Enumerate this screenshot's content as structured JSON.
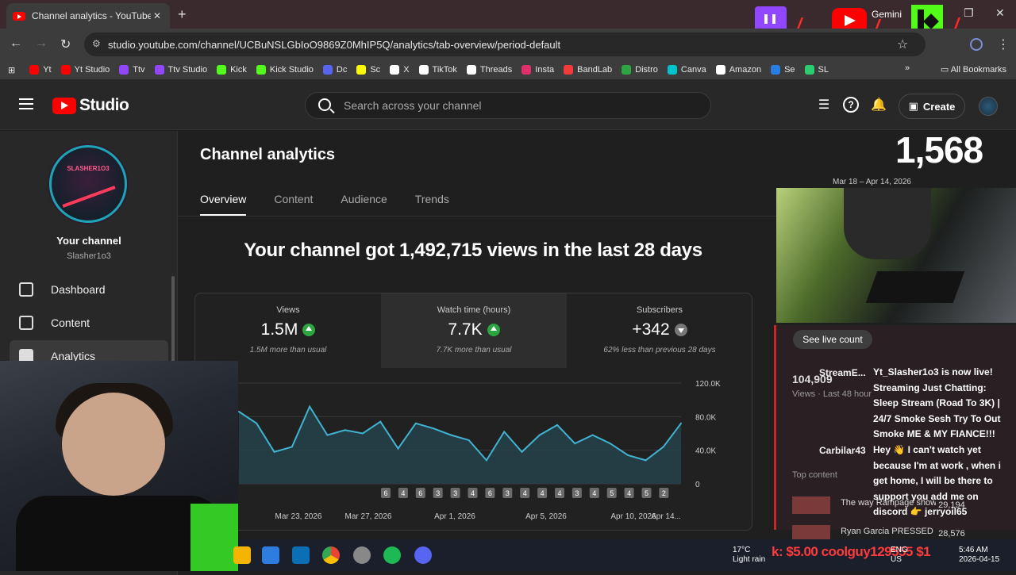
{
  "browser": {
    "tab_title": "Channel analytics - YouTube Stu",
    "url": "studio.youtube.com/channel/UCBuNSLGbIoO9869Z0MhIP5Q/analytics/tab-overview/period-default",
    "gemini_label": "Gemini",
    "bookmarks": [
      "Yt",
      "Yt Studio",
      "Ttv",
      "Ttv Studio",
      "Kick",
      "Kick Studio",
      "Dc",
      "Sc",
      "X",
      "TikTok",
      "Threads",
      "Insta",
      "BandLab",
      "Distro",
      "Canva",
      "Amazon",
      "Se",
      "SL"
    ],
    "bookmark_colors": [
      "#ff0000",
      "#ff0000",
      "#9146ff",
      "#9146ff",
      "#53fc18",
      "#53fc18",
      "#5865f2",
      "#fffc00",
      "#ffffff",
      "#ffffff",
      "#ffffff",
      "#e1306c",
      "#f23c3c",
      "#2ba640",
      "#00c4cc",
      "#ffffff",
      "#2a7de1",
      "#2ecc71"
    ],
    "all_bookmarks": "All Bookmarks"
  },
  "header": {
    "logo_text": "Studio",
    "search_placeholder": "Search across your channel",
    "create_label": "Create"
  },
  "sidebar": {
    "avatar_text": "SLASHER1O3",
    "your_channel": "Your channel",
    "handle": "Slasher1o3",
    "items": [
      {
        "label": "Dashboard"
      },
      {
        "label": "Content"
      },
      {
        "label": "Analytics"
      }
    ]
  },
  "main": {
    "title": "Channel analytics",
    "tabs": [
      "Overview",
      "Content",
      "Audience",
      "Trends"
    ],
    "headline": "Your channel got 1,492,715 views in the last 28 days",
    "metrics": [
      {
        "label": "Views",
        "value": "1.5M",
        "trend": "up",
        "sub": "1.5M more than usual"
      },
      {
        "label": "Watch time (hours)",
        "value": "7.7K",
        "trend": "up",
        "sub": "7.7K more than usual"
      },
      {
        "label": "Subscribers",
        "value": "+342",
        "trend": "down",
        "sub": "62% less than previous 28 days"
      }
    ]
  },
  "chart_data": {
    "type": "area",
    "title": "",
    "xlabel": "",
    "ylabel": "",
    "y_ticks": [
      "120.0K",
      "80.0K",
      "40.0K",
      "0"
    ],
    "ylim": [
      0,
      120000
    ],
    "x_tick_labels": [
      "Mar 23, 2026",
      "Mar 27, 2026",
      "Apr 1, 2026",
      "Apr 5, 2026",
      "Apr 10, 2026",
      "Apr 14..."
    ],
    "values": [
      86000,
      72000,
      38000,
      44000,
      92000,
      58000,
      64000,
      60000,
      74000,
      42000,
      72000,
      66000,
      58000,
      52000,
      28000,
      62000,
      38000,
      58000,
      70000,
      48000,
      58000,
      48000,
      34000,
      28000,
      44000,
      72000
    ],
    "markers": [
      "6",
      "4",
      "6",
      "3",
      "3",
      "4",
      "6",
      "3",
      "4",
      "4",
      "4",
      "3",
      "4",
      "5",
      "4",
      "5",
      "2"
    ],
    "grid": true,
    "colors": {
      "line": "#41b4d2",
      "fill": "#26444d",
      "marker_bg": "#6b6b6b"
    }
  },
  "overlays": {
    "big_count": "1,568",
    "date_range": "Mar 18 – Apr 14, 2026",
    "see_live_count": "See live count",
    "ghost_views_value": "104,909",
    "ghost_views_label": "Views · Last 48 hour",
    "top_content_label": "Top content",
    "top_content": [
      {
        "title": "The way Rampage show...",
        "views": "29,194"
      },
      {
        "title": "Ryan Garcia PRESSED O...",
        "views": "28,576"
      }
    ],
    "chat": [
      {
        "user": "StreamE...",
        "user_color": "#7c5cff",
        "text": "Yt_Slasher1o3 is now live! Streaming Just Chatting: Sleep Stream (Road To 3K) | 24/7 Smoke Sesh Try To Out Smoke ME & MY FIANCE!!!"
      },
      {
        "user": "Carbilar43",
        "user_color": "#ff6b6b",
        "text": "Hey 👋 I can't watch yet because I'm at work , when i get home, I will be there to support you add me on discord 👉 jerryoil65"
      }
    ],
    "ticker": "k: $5.00  coolguy129555 $1",
    "weather_temp": "17°C",
    "weather_desc": "Light rain",
    "clock_time": "5:46 AM",
    "clock_date": "2026-04-15",
    "lang": "ENG",
    "region": "US"
  }
}
